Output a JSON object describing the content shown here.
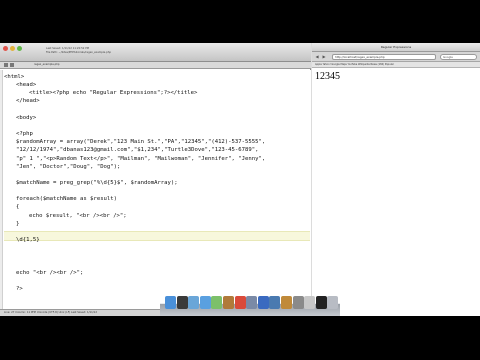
{
  "editor": {
    "titlebar": {
      "meta_line_1": "Last Saved: 1/11/12 11:20:52 PM",
      "meta_line_2": "File Path: ~/Sites/PHPtutorials/regex_example.php"
    },
    "tabbar": {
      "tab_label": "regex_example.php"
    },
    "code_lines": [
      {
        "indent": 0,
        "text": "<html>"
      },
      {
        "indent": 1,
        "text": "<head>"
      },
      {
        "indent": 2,
        "text": "<title><?php echo \"Regular Expressions\";?></title>"
      },
      {
        "indent": 1,
        "text": "</head>"
      },
      {
        "indent": 0,
        "text": ""
      },
      {
        "indent": 1,
        "text": "<body>"
      },
      {
        "indent": 0,
        "text": ""
      },
      {
        "indent": 1,
        "text": "<?php"
      },
      {
        "indent": 1,
        "text": "$randomArray = array(\"Derek\",\"123 Main St.\",\"PA\",\"12345\",\"(412)-537-5555\","
      },
      {
        "indent": 1,
        "text": "\"12/12/1974\",\"dbanas123@gmail.com\",\"$1,234\",\"Turtle3Dove\",\"123-45-6789\","
      },
      {
        "indent": 1,
        "text": "\"p\" 1 \",\"<p>Random Text</p>\", \"Mailman\", \"Mailwoman\", \"Jennifer\", \"Jenny\","
      },
      {
        "indent": 1,
        "text": "\"Jen\", \"Doctor\",\"Doug\", \"Dog\");"
      },
      {
        "indent": 0,
        "text": ""
      },
      {
        "indent": 1,
        "text": "$matchName = preg_grep(\"%\\d{5}$\", $randomArray);"
      },
      {
        "indent": 0,
        "text": ""
      },
      {
        "indent": 1,
        "text": "foreach($matchName as $result)"
      },
      {
        "indent": 1,
        "text": "{"
      },
      {
        "indent": 2,
        "text": "echo $result, \"<br /><br />\";"
      },
      {
        "indent": 1,
        "text": "}"
      },
      {
        "indent": 0,
        "text": ""
      },
      {
        "indent": 1,
        "text": "\\d{1,5}"
      },
      {
        "indent": 0,
        "text": ""
      },
      {
        "indent": 0,
        "text": ""
      },
      {
        "indent": 0,
        "text": ""
      },
      {
        "indent": 1,
        "text": "echo \"<br /><br />\";"
      },
      {
        "indent": 0,
        "text": ""
      },
      {
        "indent": 1,
        "text": "?>"
      }
    ],
    "statusbar": {
      "text": "Line: 27   Column: 11   PHP   Unicode (UTF-8)   Unix (LF)   Last Saved: 1/11/12"
    }
  },
  "browser": {
    "title": "Regular Expressions",
    "url": "http://localhost/regex_example.php",
    "search_placeholder": "Google",
    "bookmarks": "Apple  Yahoo!  Google Maps  YouTube  Wikipedia  News (184)  Popular",
    "output_text": "12345",
    "nav": {
      "back_icon": "◀",
      "forward_icon": "▶"
    }
  },
  "dock": {
    "icons": [
      {
        "name": "finder-icon",
        "color": "#4a90d9"
      },
      {
        "name": "dashboard-icon",
        "color": "#3a3a3a"
      },
      {
        "name": "mail-icon",
        "color": "#6aa6d8"
      },
      {
        "name": "safari-icon",
        "color": "#5aa0e0"
      },
      {
        "name": "ichat-icon",
        "color": "#7cc06a"
      },
      {
        "name": "address-book-icon",
        "color": "#b07a3a"
      },
      {
        "name": "ical-icon",
        "color": "#d94a3a"
      },
      {
        "name": "preview-icon",
        "color": "#7a8aa6"
      },
      {
        "name": "itunes-icon",
        "color": "#3a6ac0"
      },
      {
        "name": "iphoto-icon",
        "color": "#4a7ab0"
      },
      {
        "name": "garageband-icon",
        "color": "#c08a3a"
      },
      {
        "name": "system-preferences-icon",
        "color": "#8a8a8a"
      },
      {
        "name": "textwrangler-icon",
        "color": "#c8c8c8"
      },
      {
        "name": "terminal-icon",
        "color": "#222222"
      },
      {
        "name": "trash-icon",
        "color": "#b8bcc4"
      }
    ]
  }
}
